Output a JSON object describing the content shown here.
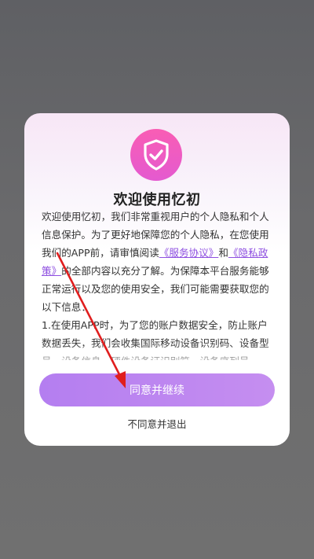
{
  "dialog": {
    "title": "欢迎使用忆初",
    "body": {
      "part1": "欢迎使用忆初，我们非常重视用户的个人隐私和个人信息保护。为了更好地保障您的个人隐私，在您使用我们的APP前，请审慎阅读",
      "link_service": "《服务协议》",
      "and": "和",
      "link_privacy": "《隐私政策》",
      "part2": "的全部内容以充分了解。为保障本平台服务能够正常运行以及您的使用安全，我们可能需要获取您的以下信息：",
      "point1": "1.在使用APP时，为了您的账户数据安全，防止账户数据丢失，我们会收集国际移动设备识别码、设备型号、设备信息、硬件设备证识别符、设备序列号"
    },
    "agree_label": "同意并继续",
    "decline_label": "不同意并退出"
  },
  "icons": {
    "badge": "shield-check-icon",
    "annotation": "red-arrow-icon"
  },
  "colors": {
    "accent": "#b47ef0",
    "link": "#8e4fe0",
    "badge": "#f95db4",
    "arrow": "#e01e1e"
  }
}
